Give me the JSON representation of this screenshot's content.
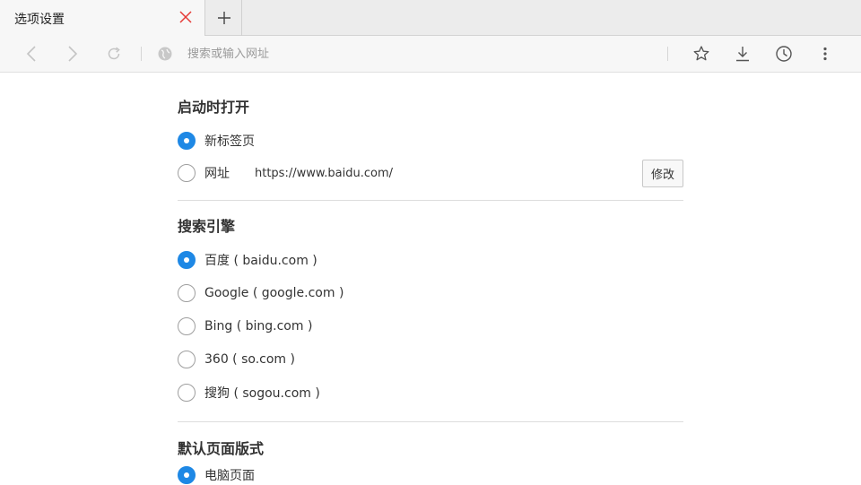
{
  "tab": {
    "title": "选项设置"
  },
  "toolbar": {
    "address_placeholder": "搜索或输入网址"
  },
  "settings": {
    "startup": {
      "title": "启动时打开",
      "options": [
        {
          "label": "新标签页",
          "checked": true
        },
        {
          "label": "网址",
          "checked": false
        }
      ],
      "url": "https://www.baidu.com/",
      "modify_label": "修改"
    },
    "search_engine": {
      "title": "搜索引擎",
      "options": [
        {
          "label": "百度 ( baidu.com )",
          "checked": true
        },
        {
          "label": "Google ( google.com )",
          "checked": false
        },
        {
          "label": "Bing ( bing.com )",
          "checked": false
        },
        {
          "label": "360 ( so.com )",
          "checked": false
        },
        {
          "label": "搜狗 ( sogou.com )",
          "checked": false
        }
      ]
    },
    "page_mode": {
      "title": "默认页面版式",
      "options": [
        {
          "label": "电脑页面",
          "checked": true
        }
      ]
    }
  },
  "colors": {
    "accent": "#1e88e5",
    "close_icon": "#e53935"
  }
}
